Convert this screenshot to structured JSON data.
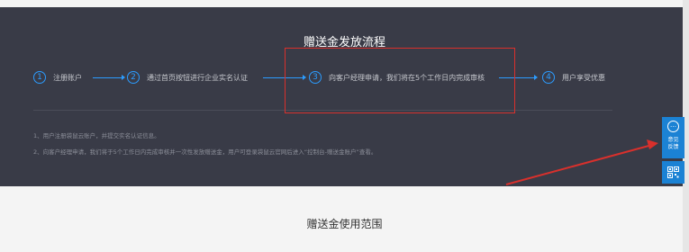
{
  "flow": {
    "title": "赠送金发放流程",
    "steps": [
      {
        "num": "1",
        "label": "注册账户"
      },
      {
        "num": "2",
        "label": "通过首页按钮进行企业实名认证"
      },
      {
        "num": "3",
        "label": "向客户经理申请，我们将在5个工作日内完成审核"
      },
      {
        "num": "4",
        "label": "用户享受优惠"
      }
    ],
    "notes": [
      "1、用户注册袋鼠云账户，并提交实名认证信息。",
      "2、向客户经理申请，我们将于5个工作日内完成审核并一次性发放赠送金，用户可登录袋鼠云官网后进入“控制台-赠送金账户”查看。"
    ]
  },
  "usage": {
    "title": "赠送金使用范围"
  },
  "floating": {
    "feedback_label": "意见反馈",
    "feedback_icon": "…"
  },
  "colors": {
    "dark_bg": "#393b47",
    "accent_blue": "#2c9cff",
    "highlight_red": "#d9302c",
    "float_blue": "#1b82d4"
  }
}
